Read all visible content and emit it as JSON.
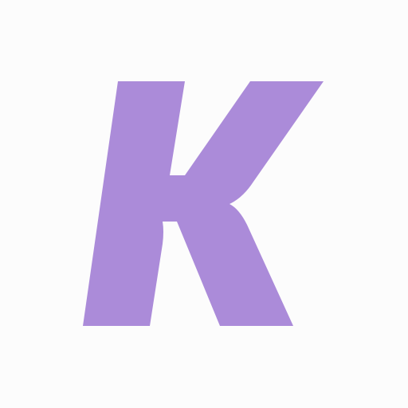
{
  "logo": {
    "letter": "K",
    "color": "#ab8bd9",
    "background": "#fcfcfc"
  }
}
